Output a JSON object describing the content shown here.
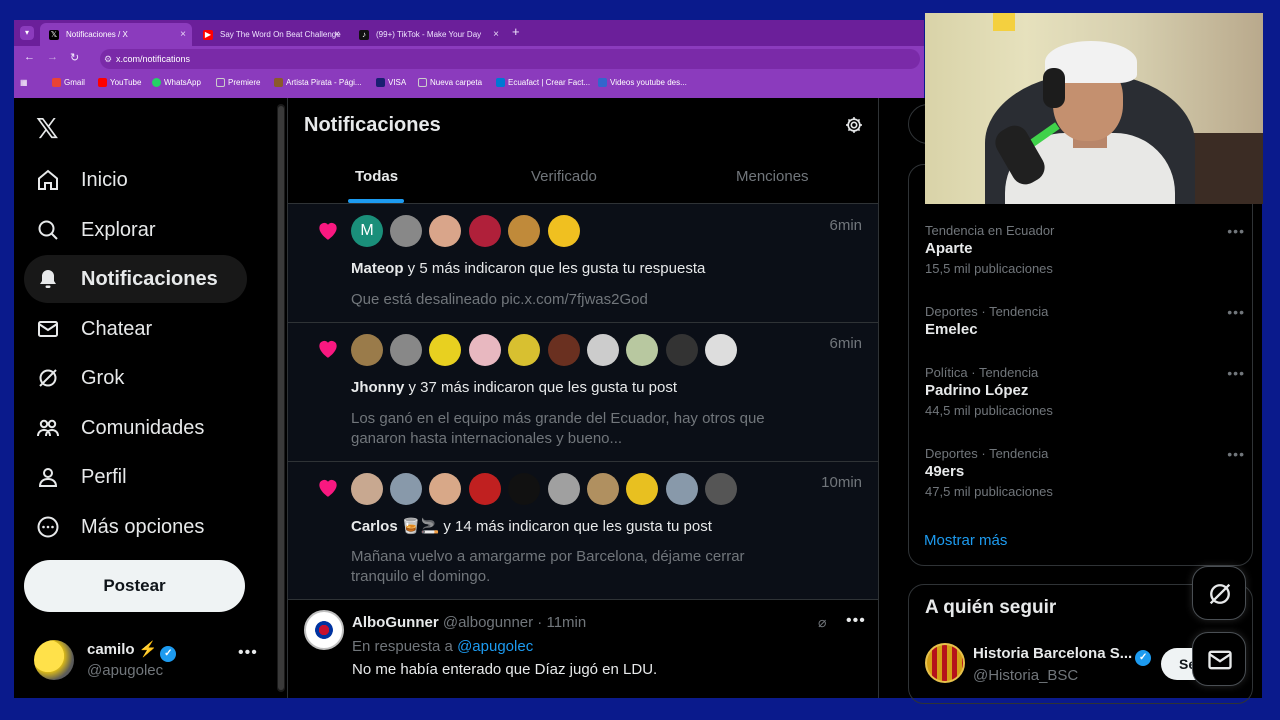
{
  "browser": {
    "tabs": [
      {
        "label": "Notificaciones / X",
        "icon": "x-logo-icon",
        "active": true
      },
      {
        "label": "Say The Word On Beat Challenge",
        "icon": "youtube-icon",
        "active": false
      },
      {
        "label": "(99+) TikTok - Make Your Day",
        "icon": "tiktok-icon",
        "active": false
      }
    ],
    "url": "x.com/notifications",
    "bookmarks": [
      {
        "label": "Gmail",
        "color": "#ea4335"
      },
      {
        "label": "YouTube",
        "color": "#ff0000"
      },
      {
        "label": "WhatsApp",
        "color": "#25d366"
      },
      {
        "label": "Premiere",
        "color": "#cccccc"
      },
      {
        "label": "Artista Pirata - Pági...",
        "color": "#8b5a2b"
      },
      {
        "label": "VISA",
        "color": "#1a1f71"
      },
      {
        "label": "Nueva carpeta",
        "color": "#cccccc"
      },
      {
        "label": "Ecuafact | Crear Fact...",
        "color": "#0078d4"
      },
      {
        "label": "Videos youtube des...",
        "color": "#3366cc"
      }
    ]
  },
  "nav": {
    "items": [
      {
        "label": "Inicio",
        "icon": "home-icon"
      },
      {
        "label": "Explorar",
        "icon": "search-icon"
      },
      {
        "label": "Notificaciones",
        "icon": "bell-icon",
        "active": true
      },
      {
        "label": "Chatear",
        "icon": "mail-icon"
      },
      {
        "label": "Grok",
        "icon": "grok-icon"
      },
      {
        "label": "Comunidades",
        "icon": "communities-icon"
      },
      {
        "label": "Perfil",
        "icon": "profile-icon"
      },
      {
        "label": "Más opciones",
        "icon": "more-options-icon"
      }
    ],
    "post_label": "Postear",
    "account": {
      "name": "camilo ⚡",
      "handle": "@apugolec"
    }
  },
  "main": {
    "title": "Notificaciones",
    "tabs": [
      "Todas",
      "Verificado",
      "Menciones"
    ],
    "notifications": [
      {
        "time": "6min",
        "actor": "Mateop",
        "text": " y 5 más indicaron que les gusta tu respuesta",
        "sub": "Que está desalineado pic.x.com/7fjwas2God",
        "avatars": [
          "#1a8f7a",
          "#888888",
          "#d9a58a",
          "#b0203a",
          "#c08a3a",
          "#f0c020"
        ],
        "avatar_letter": "M"
      },
      {
        "time": "6min",
        "actor": "Jhonny",
        "text": " y 37 más indicaron que les gusta tu post",
        "sub": "Los ganó en el equipo más grande del Ecuador, hay otros que ganaron hasta internacionales y bueno...",
        "avatars": [
          "#9a7b4a",
          "#888888",
          "#e8d020",
          "#e8b8c0",
          "#d8c030",
          "#6a3020",
          "#cccccc",
          "#b8c8a0",
          "#333333",
          "#dddddd"
        ]
      },
      {
        "time": "10min",
        "actor": "Carlos 🥃🚬",
        "text": " y 14 más indicaron que les gusta tu post",
        "sub": "Mañana vuelvo a amargarme por Barcelona, déjame cerrar tranquilo el domingo.",
        "avatars": [
          "#c8a890",
          "#8899aa",
          "#d8a888",
          "#c02020",
          "#111111",
          "#a0a0a0",
          "#b09060",
          "#e8c020",
          "#8899aa",
          "#555555"
        ]
      }
    ],
    "reply": {
      "name": "AlboGunner",
      "handle": "@albogunner",
      "time": "11min",
      "in_reply_prefix": "En respuesta a ",
      "in_reply_to": "@apugolec",
      "body": "No me había enterado que Díaz jugó en LDU."
    }
  },
  "right": {
    "trends": [
      {
        "context": "Tendencia en Ecuador",
        "name": "Aparte",
        "posts": "15,5 mil publicaciones"
      },
      {
        "context": "Deportes · Tendencia",
        "name": "Emelec",
        "posts": ""
      },
      {
        "context": "Política · Tendencia",
        "name": "Padrino López",
        "posts": "44,5 mil publicaciones"
      },
      {
        "context": "Deportes · Tendencia",
        "name": "49ers",
        "posts": "47,5 mil publicaciones"
      }
    ],
    "show_more": "Mostrar más",
    "who_to_follow": {
      "title": "A quién seguir",
      "name": "Historia Barcelona S...",
      "handle": "@Historia_BSC",
      "button": "Se"
    }
  },
  "colors": {
    "accent": "#1d9bf0",
    "like": "#f91880",
    "text": "#e7e9ea",
    "muted": "#71767b"
  }
}
